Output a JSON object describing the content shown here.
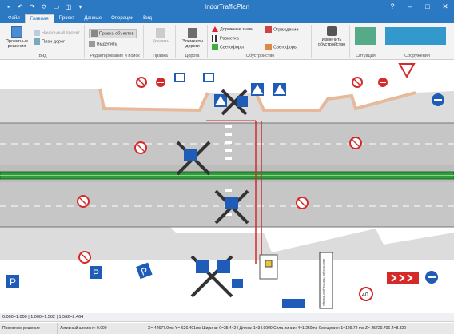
{
  "app": {
    "title": "IndorTrafficPlan"
  },
  "colors": {
    "accent": "#2b79c2",
    "road": "#c6c6c6",
    "sidewalk": "#dcdcdc",
    "curb_edge": "#e7b99a",
    "median": "#2f9e3a",
    "stop_line": "#d42a2a"
  },
  "tabs": [
    {
      "label": "Файл"
    },
    {
      "label": "Главная"
    },
    {
      "label": "Проект"
    },
    {
      "label": "Данные"
    },
    {
      "label": "Операции"
    },
    {
      "label": "Вид"
    }
  ],
  "ribbon": {
    "proektnye": "Проектные решения",
    "vid_label": "Вид",
    "nachalnyi": "Начальный проект",
    "prjaviti": "План дорог",
    "redakt_label": "Редактирование и поиск",
    "pravka_obj": "Правка объектов",
    "vydelit": "Выделить",
    "udalit": "Удалить",
    "pravka_label": "Правка",
    "elementy": "Элементы дороги",
    "doroga_label": "Дорога",
    "dorozhnye_znaki": "Дорожные знаки",
    "razmetka": "Разметка",
    "svetofory": "Светофоры",
    "ograzhdenie": "Ограждение",
    "svetofory2": "Светофоры",
    "obustr_label": "Обустройство",
    "izmenit": "Изменить обустройство",
    "situaciya_label": "Ситуация",
    "sooruzhenie_label": "Сооружения"
  },
  "signs": [
    {
      "type": "no-parking"
    },
    {
      "type": "no-entry"
    },
    {
      "type": "lanes"
    },
    {
      "type": "lanes"
    },
    {
      "type": "crosswalk"
    },
    {
      "type": "crosswalk"
    },
    {
      "type": "crosswalk"
    },
    {
      "type": "no-parking"
    },
    {
      "type": "no-parking"
    },
    {
      "type": "no-parking"
    },
    {
      "type": "no-parking"
    },
    {
      "type": "no-parking"
    },
    {
      "type": "no-parking"
    },
    {
      "type": "no-parking"
    },
    {
      "type": "yield"
    },
    {
      "type": "direction"
    },
    {
      "type": "parking"
    },
    {
      "type": "parking"
    },
    {
      "type": "parking"
    },
    {
      "type": "speed-limit"
    },
    {
      "type": "chevron"
    },
    {
      "type": "keep-right"
    },
    {
      "type": "info-board"
    }
  ],
  "canvas_text": {
    "speed_limit": "40",
    "parking": "P",
    "info_board": "КОНСТРУКЦИЯ ТРОТУАР ДЛЯ ПРОХОДА"
  },
  "status": {
    "coords": "0.000=1.000 | 1.000=1.562 | 1.562=2.464",
    "solutions": "Проектное решение",
    "active_element": "Активный элемент: 0.000",
    "info": "X=-42677.0ms  Y=-626.401ms  Ширина: 0=35.4424  Длина: 1=34.9000  Сила линии: 4=1.250ms  Смещение: 1=129.72 ms  Z=-25720.706  Z=8.820"
  }
}
